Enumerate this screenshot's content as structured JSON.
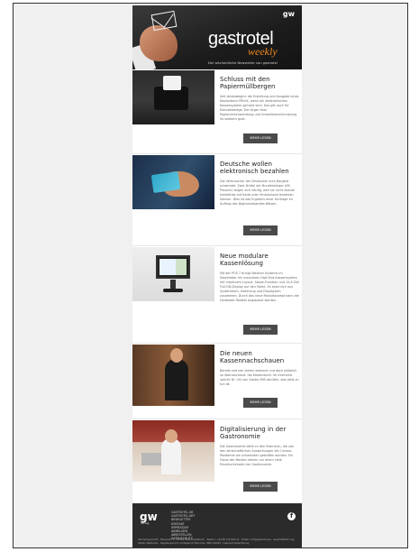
{
  "header": {
    "brand_small": "gw",
    "logo": "gastrotel",
    "logo_sub": "weekly",
    "tagline": "Der wöchentliche Newsletter von gastrotel"
  },
  "articles": [
    {
      "title": "Schluss mit den Papiermüllbergen",
      "text": "Seit Jahresbeginn die Erstellung und Ausgabe eines Kassenbons Pflicht, wenn ein elektronisches Kassensystem genutzt wird. Das gilt auch für Kleinstbeträge. Der Ärger über Papierverschwendung und Umweltverschmutzung ist seitdem groß.",
      "button": "MEHR LESEN"
    },
    {
      "title": "Deutsche wollen elektronisch bezahlen",
      "text": "Die Verbraucher der Deutschen zum Bargeld schwindet. Zwei Drittel der Bundesbürger (66 Prozent) zeigen sich häufig, weil sie nicht überall kontaktlos mit Karte oder Smartphone bezahlen können. Dies ist das Ergebnis einer Umfrage im Auftrag des Digitalverbandes Bitkom.",
      "button": "MEHR LESEN"
    },
    {
      "title": "Neue modulare Kassenlösung",
      "text": "Mit der POS 7 bringt Wedcon Systems im September ein modulares High End-Kassensystem mit intuitivem Layout, Swipe-Funktion und 15,6 Zoll Full-HD-Display auf den Markt. Es setzt sich aus Systemtisch, Halterung und Displayarm zusammen. Durch das neue Modulkonzept kann die Hardware flexibel angepasst werden.",
      "button": "MEHR LESEN"
    },
    {
      "title": "Die neuen Kassennachschauen",
      "text": "Bereits seit vier Jahren bekannt und doch plötzlich so überraschend: die Kassensicht. Im Interview spricht Dr. Ulli von Gastro-MIS darüber, was jetzt zu tun ist.",
      "button": "MEHR LESEN"
    },
    {
      "title": "Digitalisierung in der Gastronomie",
      "text": "Die Gastronomie zählt zu den Branchen, die von den wirtschaftlichen Auswirkungen der Corona-Pandemie am schwersten getroffen wurden. Ein Fokus der Medien stehen nur allem viele Einzelschicksale der Gastronomie.",
      "button": "MEHR LESEN"
    }
  ],
  "footer": {
    "logo": "gw",
    "verlag": "verlag",
    "links": [
      "GASTROTEL.DE",
      "GASTROTEL.NET",
      "NEWSLETTER",
      "KONTAKT",
      "IMPRESSUM",
      "ANMELDEN",
      "ABBESTELLEN",
      "DATENSCHUTZ"
    ],
    "facebook": "f",
    "legal": "GW Verlag GmbH · Pfauenstr. 4 · 85764 Oberschleißheim · Telefon: +49 89 315 830 11 · E-Mail: info@gastrotel.de · Geschäftsführung: Walter Weilharter · Registergericht: Amtsgericht München HRB 102063 · Datenschutzerklärung"
  }
}
